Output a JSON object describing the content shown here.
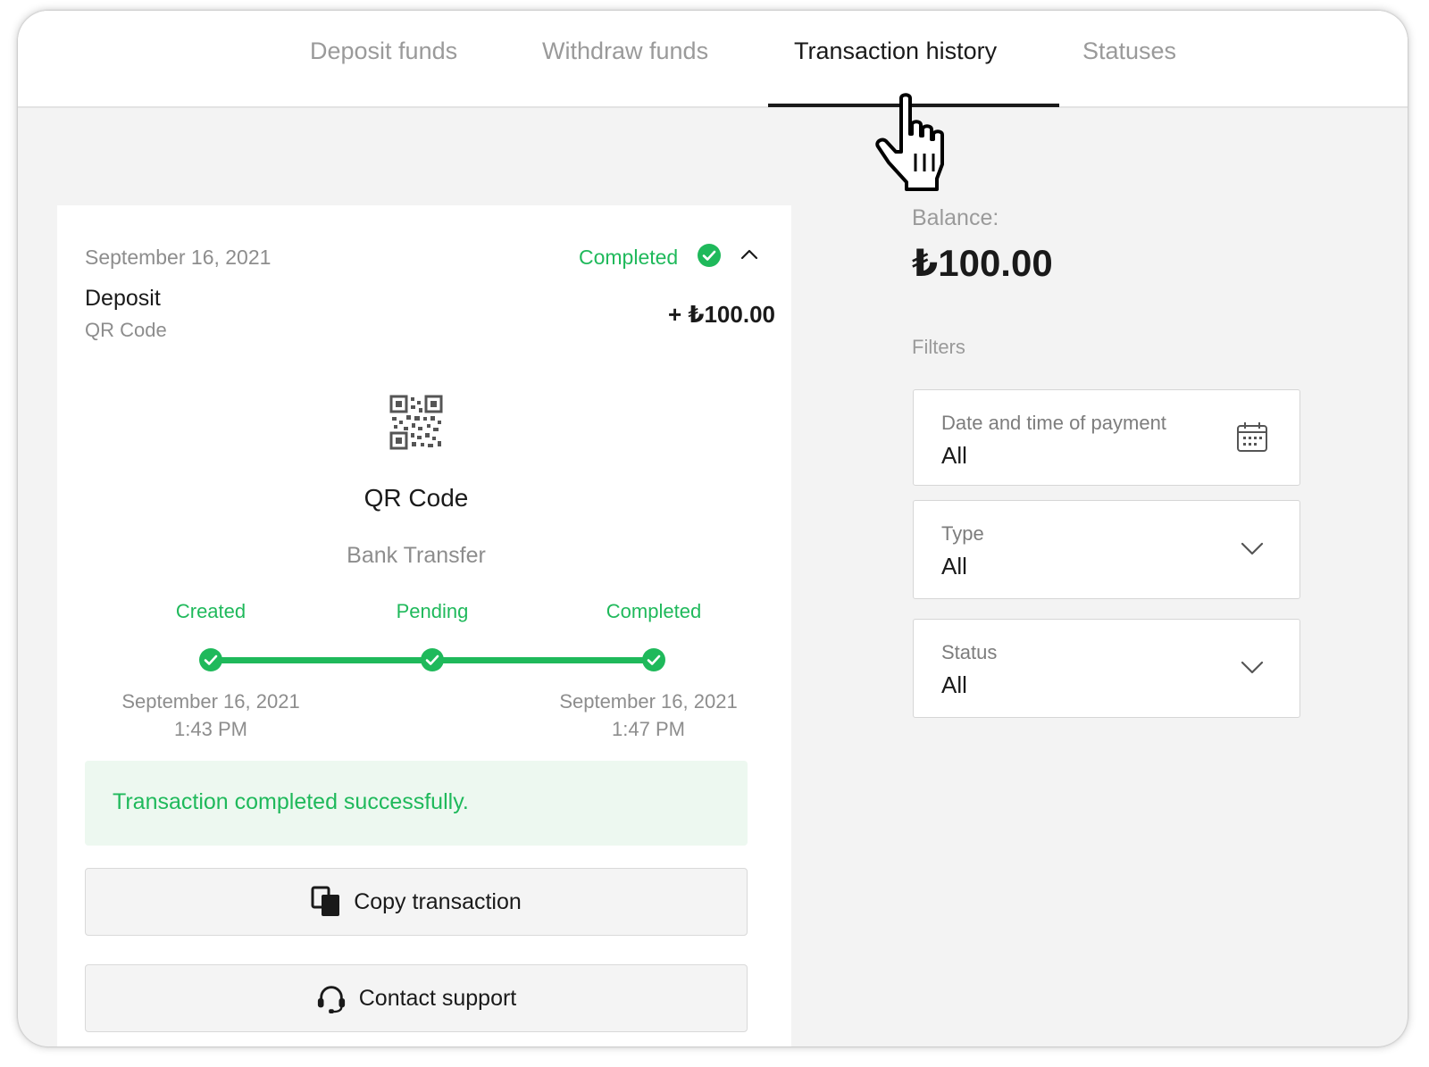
{
  "tabs": [
    {
      "label": "Deposit funds"
    },
    {
      "label": "Withdraw funds"
    },
    {
      "label": "Transaction history"
    },
    {
      "label": "Statuses"
    }
  ],
  "active_tab": "Transaction history",
  "transaction": {
    "date": "September 16, 2021",
    "status": "Completed",
    "type": "Deposit",
    "method": "QR Code",
    "amount": "+ ₺100.00",
    "method_title": "QR Code",
    "method_subtitle": "Bank Transfer",
    "steps": [
      {
        "label": "Created",
        "date": "September 16, 2021",
        "time": "1:43 PM"
      },
      {
        "label": "Pending",
        "date": "",
        "time": ""
      },
      {
        "label": "Completed",
        "date": "September 16, 2021",
        "time": "1:47 PM"
      }
    ],
    "message": "Transaction completed successfully.",
    "copy_button": "Copy transaction",
    "support_button": "Contact support"
  },
  "balance": {
    "label": "Balance:",
    "value": "₺100.00"
  },
  "filters": {
    "label": "Filters",
    "items": [
      {
        "label": "Date and time of payment",
        "value": "All",
        "icon": "calendar-icon"
      },
      {
        "label": "Type",
        "value": "All",
        "icon": "chevron-down-icon"
      },
      {
        "label": "Status",
        "value": "All",
        "icon": "chevron-down-icon"
      }
    ]
  },
  "colors": {
    "success": "#1fb95b",
    "success_bg": "#edf8f0",
    "text_primary": "#1a1a1a",
    "text_muted": "#8d8d8d"
  }
}
